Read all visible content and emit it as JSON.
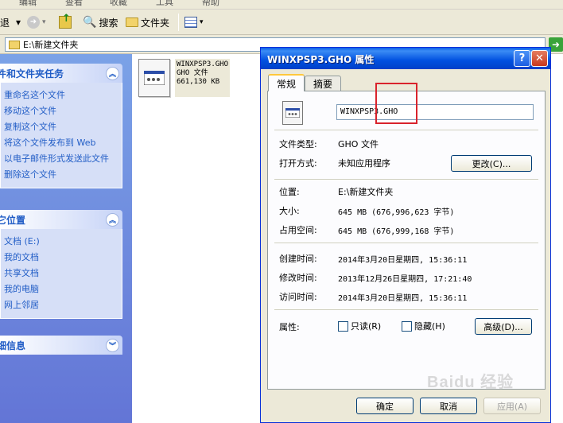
{
  "menu": [
    "编辑",
    "查看",
    "收藏",
    "工具",
    "帮助"
  ],
  "toolbar": {
    "left_partial": "退",
    "search": "搜索",
    "folders": "文件夹"
  },
  "address": {
    "path": "E:\\新建文件夹"
  },
  "tasks": {
    "file_tasks": {
      "title": "件和文件夹任务",
      "items": [
        "重命名这个文件",
        "移动这个文件",
        "复制这个文件",
        "将这个文件发布到 Web",
        "以电子邮件形式发送此文件",
        "删除这个文件"
      ]
    },
    "other_places": {
      "title": "它位置",
      "items": [
        "文档 (E:)",
        "我的文档",
        "共享文档",
        "我的电脑",
        "网上邻居"
      ]
    },
    "details": {
      "title": "细信息"
    }
  },
  "file_item": {
    "name": "WINXPSP3.GHO",
    "type": "GHO 文件",
    "size": "661,130 KB"
  },
  "dialog": {
    "title": "WINXPSP3.GHO 属性",
    "tabs": [
      "常规",
      "摘要"
    ],
    "file_name": "WINXPSP3.GHO",
    "type_label": "文件类型:",
    "type_value": "GHO 文件",
    "open_label": "打开方式:",
    "open_value": "未知应用程序",
    "change_button": "更改(C)...",
    "location_label": "位置:",
    "location_value": "E:\\新建文件夹",
    "size_label": "大小:",
    "size_value": "645 MB (676,996,623 字节)",
    "disk_label": "占用空间:",
    "disk_value": "645 MB (676,999,168 字节)",
    "created_label": "创建时间:",
    "created_value": "2014年3月20日星期四, 15:36:11",
    "modified_label": "修改时间:",
    "modified_value": "2013年12月26日星期四, 17:21:40",
    "accessed_label": "访问时间:",
    "accessed_value": "2014年3月20日星期四, 15:36:11",
    "attributes_label": "属性:",
    "readonly_label": "只读(R)",
    "hidden_label": "隐藏(H)",
    "advanced_button": "高级(D)...",
    "ok_button": "确定",
    "cancel_button": "取消",
    "apply_button": "应用(A)"
  },
  "watermark": "Baidu 经验"
}
